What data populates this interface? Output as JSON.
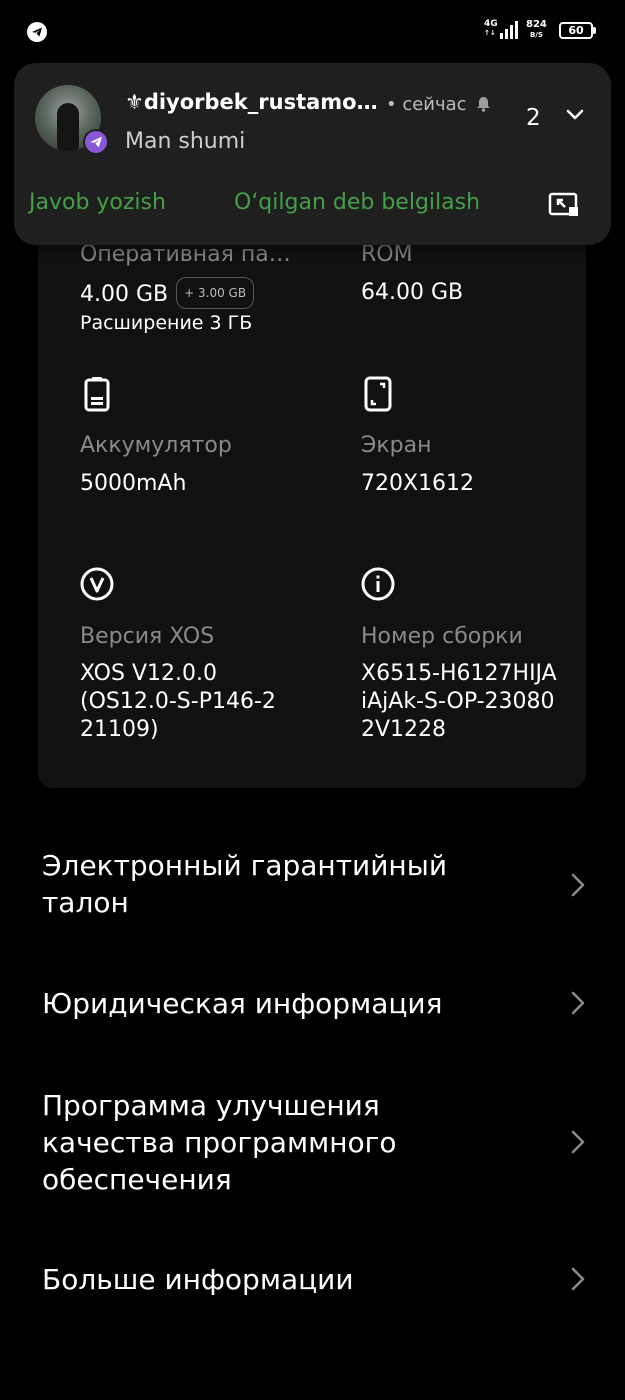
{
  "status_bar": {
    "app_icon": "telegram-icon",
    "network_type": "4G",
    "net_direction": "↑↓",
    "speed_value": "824",
    "speed_unit": "B/S",
    "battery_level": "60"
  },
  "notification": {
    "sender": "⚜diyorbek_rustamo…",
    "time": "• сейчас",
    "message": "Man shumi",
    "count": "2",
    "actions": {
      "reply": "Javob yozish",
      "mark_read": "O‘qilgan deb belgilash"
    },
    "icons": {
      "bell": "bell-icon",
      "expand": "chevron-down-icon",
      "cast": "cast-icon"
    }
  },
  "specs": {
    "ram": {
      "label": "Оперативная па…",
      "value": "4.00 GB",
      "chip": "+ 3.00 GB",
      "sub": "Расширение 3 ГБ"
    },
    "rom": {
      "label": "ROM",
      "value": "64.00 GB"
    },
    "battery": {
      "label": "Аккумулятор",
      "value": "5000mAh"
    },
    "screen": {
      "label": "Экран",
      "value": "720X1612"
    },
    "xos": {
      "label": "Версия XOS",
      "value": "XOS V12.0.0\n(OS12.0-S-P146-2\n21109)"
    },
    "build": {
      "label": "Номер сборки",
      "value": "X6515-H6127HIJA\niAjAk-S-OP-23080\n2V1228"
    }
  },
  "menu": [
    {
      "label": "Электронный гарантийный\nталон"
    },
    {
      "label": "Юридическая информация"
    },
    {
      "label": "Программа улучшения\nкачества программного\nобеспечения"
    },
    {
      "label": "Больше информации"
    }
  ],
  "colors": {
    "background": "#000000",
    "card": "#111111",
    "notification": "#1f1f1f",
    "action_green": "#43a047",
    "label_gray": "#8a8a8a"
  }
}
